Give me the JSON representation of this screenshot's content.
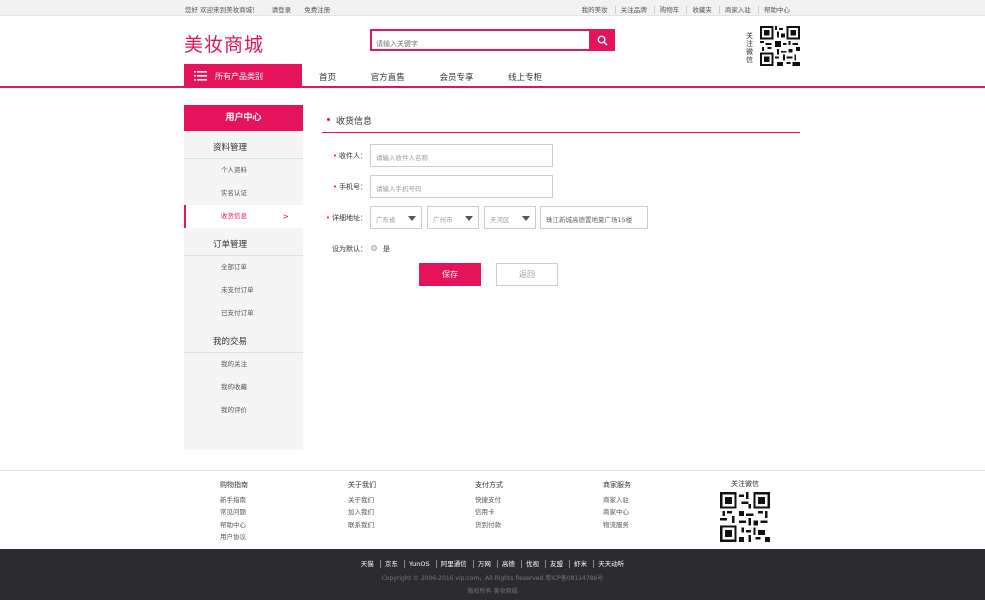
{
  "topbar": {
    "welcome": "您好 欢迎来到美妆商城！",
    "login": "请登录",
    "register": "免费注册",
    "links": [
      "我的美妆",
      "关注品牌",
      "购物车",
      "收藏夹",
      "商家入驻",
      "帮助中心"
    ]
  },
  "header": {
    "logo": "美妆商城",
    "search_placeholder": "请输入关键字",
    "qr_label": "关注微信"
  },
  "nav": {
    "category_label": "所有产品类别",
    "links": [
      "首页",
      "官方直售",
      "会员专享",
      "线上专柜"
    ]
  },
  "sidebar": {
    "title": "用户中心",
    "groups": [
      {
        "title": "资料管理",
        "items": [
          "个人资料",
          "实名认证",
          "收货信息"
        ]
      },
      {
        "title": "订单管理",
        "items": [
          "全部订单",
          "未支付订单",
          "已支付订单"
        ]
      },
      {
        "title": "我的交易",
        "items": [
          "我的关注",
          "我的收藏",
          "我的评价"
        ]
      }
    ],
    "active_item": "收货信息"
  },
  "form": {
    "title": "收货信息",
    "receiver_label": "收件人：",
    "receiver_placeholder": "请输入收件人名称",
    "phone_label": "手机号：",
    "phone_placeholder": "请输入手机号码",
    "address_label": "详细地址：",
    "province": "广东省",
    "city": "广州市",
    "district": "天河区",
    "street": "珠江新城高德置地夏广场15楼",
    "default_label": "设为默认：",
    "default_option": "是",
    "save": "保存",
    "back": "返回"
  },
  "footer": {
    "columns": [
      {
        "title": "购物指南",
        "items": [
          "新手指南",
          "常见问题",
          "帮助中心",
          "用户协议"
        ]
      },
      {
        "title": "关于我们",
        "items": [
          "关于我们",
          "加入我们",
          "联系我们"
        ]
      },
      {
        "title": "支付方式",
        "items": [
          "快捷支付",
          "信用卡",
          "货到付款"
        ]
      },
      {
        "title": "商家服务",
        "items": [
          "商家入驻",
          "商家中心",
          "物流服务"
        ]
      }
    ],
    "qr_title": "关注微信",
    "partner_links": [
      "天猫",
      "京东",
      "YunOS",
      "阿里通信",
      "万网",
      "高德",
      "优视",
      "友盟",
      "虾米",
      "天天动听"
    ],
    "copyright": "Copyright © 2006-2016 vip.com，All Rights Reserved 粤ICP备08114786号",
    "rights": "版权所有  美妆商城"
  },
  "colors": {
    "accent": "#e4135c",
    "footer_bg": "#2b2b30"
  }
}
